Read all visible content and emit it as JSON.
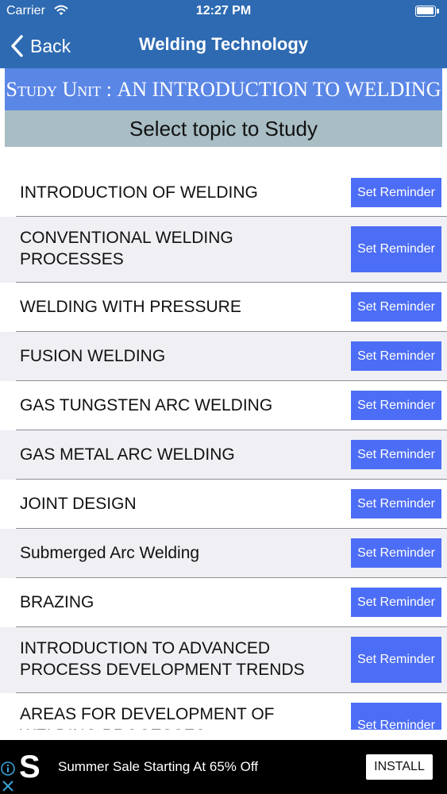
{
  "status_bar": {
    "carrier": "Carrier",
    "time": "12:27 PM"
  },
  "nav": {
    "back_label": "Back",
    "title": "Welding Technology"
  },
  "unit_banner": {
    "prefix": "Study Unit",
    "separator": " : ",
    "unit_name": "AN INTRODUCTION TO WELDING"
  },
  "select_prompt": "Select topic to Study",
  "topics": [
    {
      "title": "INTRODUCTION OF WELDING",
      "button": "Set Reminder"
    },
    {
      "title": "CONVENTIONAL WELDING PROCESSES",
      "button": "Set Reminder"
    },
    {
      "title": "WELDING WITH PRESSURE",
      "button": "Set Reminder"
    },
    {
      "title": "FUSION WELDING",
      "button": "Set Reminder"
    },
    {
      "title": "GAS TUNGSTEN ARC WELDING",
      "button": "Set Reminder"
    },
    {
      "title": "GAS METAL ARC WELDING",
      "button": "Set Reminder"
    },
    {
      "title": "JOINT DESIGN",
      "button": "Set Reminder"
    },
    {
      "title": "Submerged Arc Welding",
      "button": "Set Reminder"
    },
    {
      "title": "BRAZING",
      "button": "Set Reminder"
    },
    {
      "title": "INTRODUCTION TO ADVANCED PROCESS DEVELOPMENT TRENDS",
      "button": "Set Reminder"
    },
    {
      "title": "AREAS FOR DEVELOPMENT OF WELDING PROCESSES",
      "button": "Set Reminder"
    }
  ],
  "ad": {
    "logo_letter": "S",
    "text": "Summer Sale Starting At 65% Off",
    "install_label": "INSTALL"
  },
  "colors": {
    "nav_bar": "#2e6ab2",
    "unit_banner": "#5a86e6",
    "select_banner": "#a8bdc4",
    "reminder_button": "#4c6df5",
    "row_alt": "#efeff4"
  },
  "icons": [
    "wifi-icon",
    "battery-icon",
    "chevron-left-icon",
    "ad-info-icon",
    "ad-close-icon",
    "ad-logo-icon"
  ]
}
